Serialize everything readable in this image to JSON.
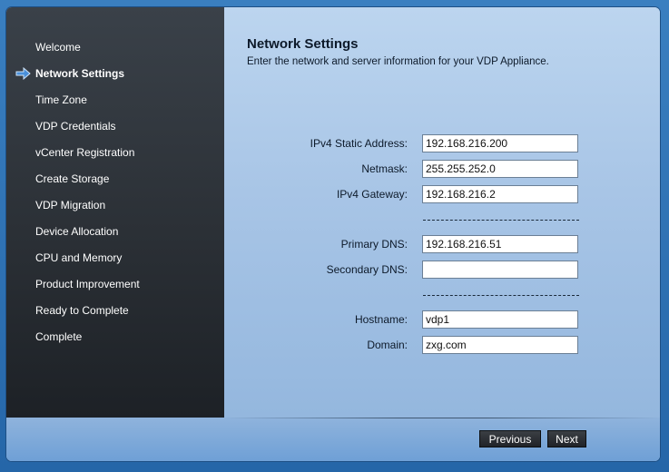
{
  "sidebar": {
    "items": [
      {
        "label": "Welcome",
        "active": false
      },
      {
        "label": "Network Settings",
        "active": true
      },
      {
        "label": "Time Zone",
        "active": false
      },
      {
        "label": "VDP Credentials",
        "active": false
      },
      {
        "label": "vCenter Registration",
        "active": false
      },
      {
        "label": "Create Storage",
        "active": false
      },
      {
        "label": "VDP Migration",
        "active": false
      },
      {
        "label": "Device Allocation",
        "active": false
      },
      {
        "label": "CPU and Memory",
        "active": false
      },
      {
        "label": "Product Improvement",
        "active": false
      },
      {
        "label": "Ready to Complete",
        "active": false
      },
      {
        "label": "Complete",
        "active": false
      }
    ],
    "active_icon": "arrow-right-icon"
  },
  "main": {
    "title": "Network Settings",
    "subtitle": "Enter the network and server information for your VDP Appliance.",
    "fields": {
      "ipv4_static_address": {
        "label": "IPv4 Static Address:",
        "value": "192.168.216.200"
      },
      "netmask": {
        "label": "Netmask:",
        "value": "255.255.252.0"
      },
      "ipv4_gateway": {
        "label": "IPv4 Gateway:",
        "value": "192.168.216.2"
      },
      "primary_dns": {
        "label": "Primary DNS:",
        "value": "192.168.216.51"
      },
      "secondary_dns": {
        "label": "Secondary DNS:",
        "value": ""
      },
      "hostname": {
        "label": "Hostname:",
        "value": "vdp1"
      },
      "domain": {
        "label": "Domain:",
        "value": "zxg.com"
      }
    }
  },
  "footer": {
    "previous_label": "Previous",
    "next_label": "Next"
  },
  "colors": {
    "accent": "#4a90d9",
    "sidebar_bg": "#2b3036",
    "content_bg": "#a8c5e6"
  }
}
